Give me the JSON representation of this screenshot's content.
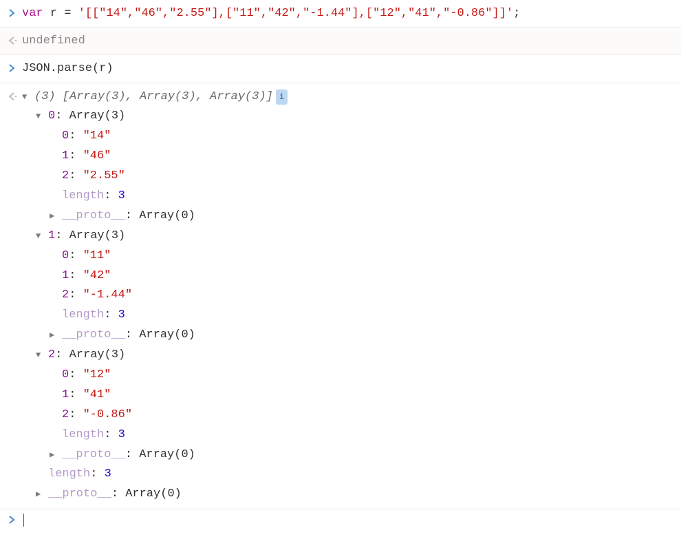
{
  "input1": {
    "kw": "var",
    "varname": " r ",
    "eq": "=",
    "str": " '[[\"14\",\"46\",\"2.55\"],[\"11\",\"42\",\"-1.44\"],[\"12\",\"41\",\"-0.86\"]]'",
    "semi": ";"
  },
  "output1": "undefined",
  "input2": "JSON.parse(r)",
  "summary": {
    "len": "(3)",
    "text": " [Array(3), Array(3), Array(3)] ",
    "badge": "i"
  },
  "arrays": [
    {
      "index": "0",
      "type": "Array(3)",
      "items": [
        {
          "i": "0",
          "v": "\"14\""
        },
        {
          "i": "1",
          "v": "\"46\""
        },
        {
          "i": "2",
          "v": "\"2.55\""
        }
      ],
      "length_label": "length",
      "length_val": "3",
      "proto_label": "__proto__",
      "proto_val": "Array(0)"
    },
    {
      "index": "1",
      "type": "Array(3)",
      "items": [
        {
          "i": "0",
          "v": "\"11\""
        },
        {
          "i": "1",
          "v": "\"42\""
        },
        {
          "i": "2",
          "v": "\"-1.44\""
        }
      ],
      "length_label": "length",
      "length_val": "3",
      "proto_label": "__proto__",
      "proto_val": "Array(0)"
    },
    {
      "index": "2",
      "type": "Array(3)",
      "items": [
        {
          "i": "0",
          "v": "\"12\""
        },
        {
          "i": "1",
          "v": "\"41\""
        },
        {
          "i": "2",
          "v": "\"-0.86\""
        }
      ],
      "length_label": "length",
      "length_val": "3",
      "proto_label": "__proto__",
      "proto_val": "Array(0)"
    }
  ],
  "outer_length_label": "length",
  "outer_length_val": "3",
  "outer_proto_label": "__proto__",
  "outer_proto_val": "Array(0)",
  "glyphs": {
    "input": "›",
    "output": "‹·",
    "down": "▼",
    "right": "▶"
  },
  "colon": ": "
}
